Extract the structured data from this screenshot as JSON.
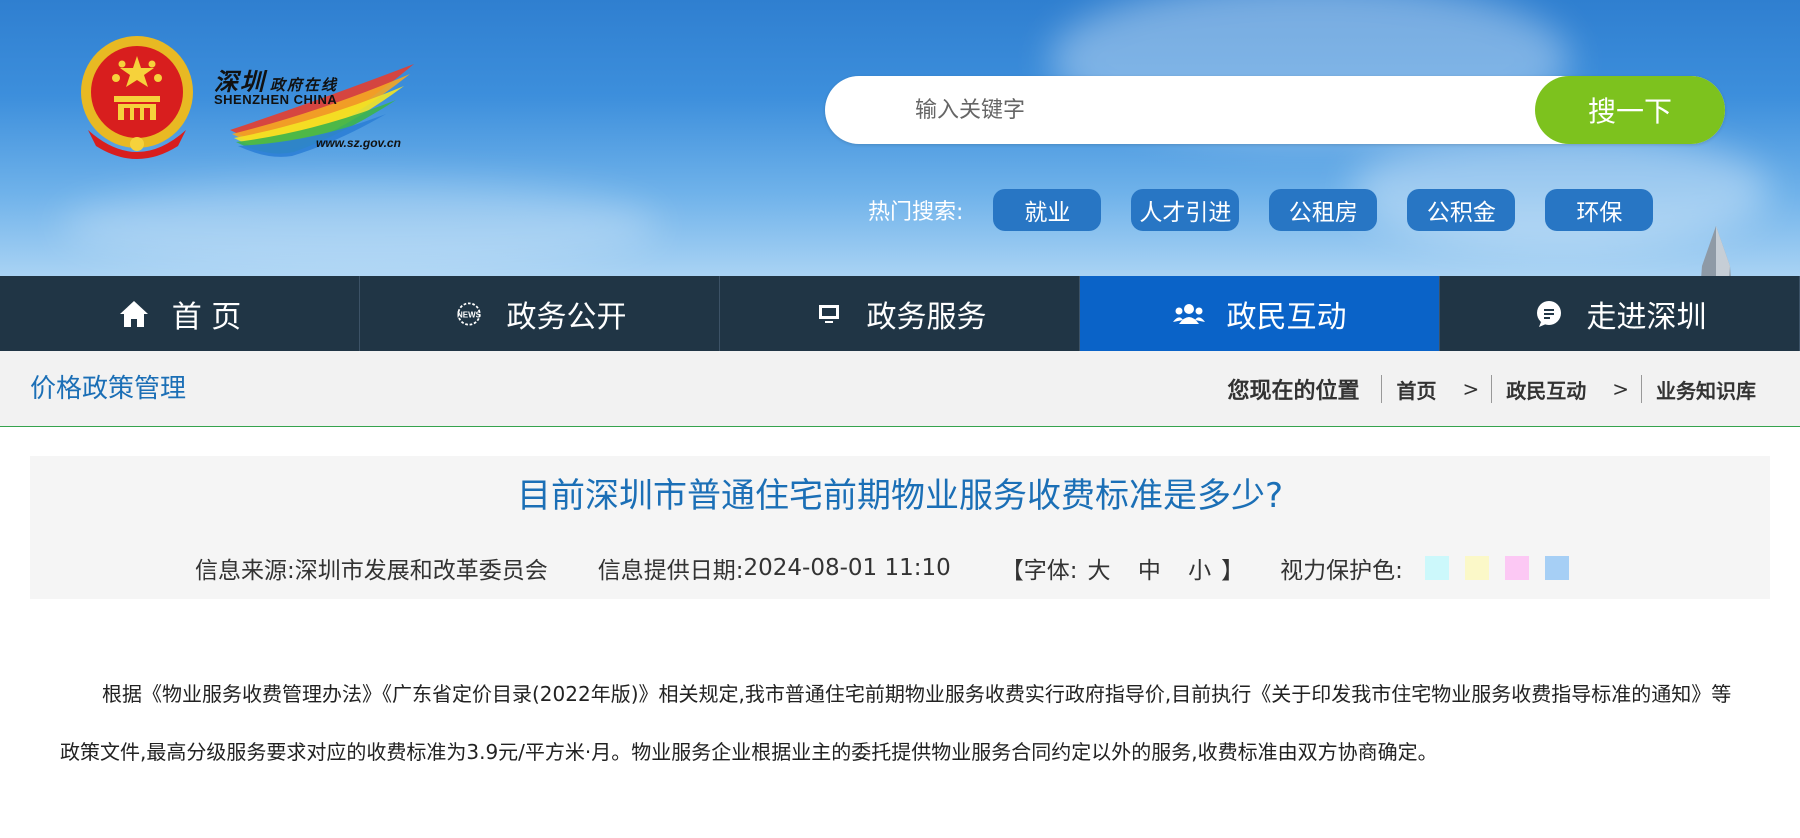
{
  "header": {
    "logo": {
      "name_cn": "深圳",
      "sub_cn": "政府在线",
      "name_en": "SHENZHEN CHINA",
      "url": "www.sz.gov.cn"
    },
    "search": {
      "placeholder": "输入关键字",
      "button_label": "搜一下"
    },
    "hot_search": {
      "label": "热门搜索:",
      "tags": [
        "就业",
        "人才引进",
        "公租房",
        "公积金",
        "环保"
      ]
    }
  },
  "nav": {
    "items": [
      {
        "label": "首 页",
        "icon": "home-icon"
      },
      {
        "label": "政务公开",
        "icon": "news-icon"
      },
      {
        "label": "政务服务",
        "icon": "monitor-icon"
      },
      {
        "label": "政民互动",
        "icon": "people-icon",
        "active": true
      },
      {
        "label": "走进深圳",
        "icon": "chat-icon"
      }
    ]
  },
  "breadcrumb_bar": {
    "section_title": "价格政策管理",
    "location_label": "您现在的位置",
    "crumbs": [
      "首页",
      "政民互动",
      "业务知识库"
    ],
    "separator": ">"
  },
  "article": {
    "title": "目前深圳市普通住宅前期物业服务收费标准是多少?",
    "source_label": "信息来源:",
    "source": "深圳市发展和改革委员会",
    "date_label": "信息提供日期:",
    "date": "2024-08-01 11:10",
    "font_label_open": "【字体:",
    "font_sizes": [
      "大",
      "中",
      "小"
    ],
    "font_label_close": "】",
    "eye_care_label": "视力保护色:",
    "eye_care_colors": [
      "#ccf8fb",
      "#fbf8c8",
      "#fcc8f4",
      "#a6cff5"
    ],
    "body": "根据《物业服务收费管理办法》《广东省定价目录(2022年版)》相关规定,我市普通住宅前期物业服务收费实行政府指导价,目前执行《关于印发我市住宅物业服务收费指导标准的通知》等政策文件,最高分级服务要求对应的收费标准为3.9元/平方米·月。物业服务企业根据业主的委托提供物业服务合同约定以外的服务,收费标准由双方协商确定。"
  },
  "colors": {
    "nav_bg": "#203545",
    "nav_active": "#0a63c8",
    "search_button": "#7dc21e",
    "hot_tag": "#2876c4",
    "title_blue": "#1b6fb6"
  }
}
